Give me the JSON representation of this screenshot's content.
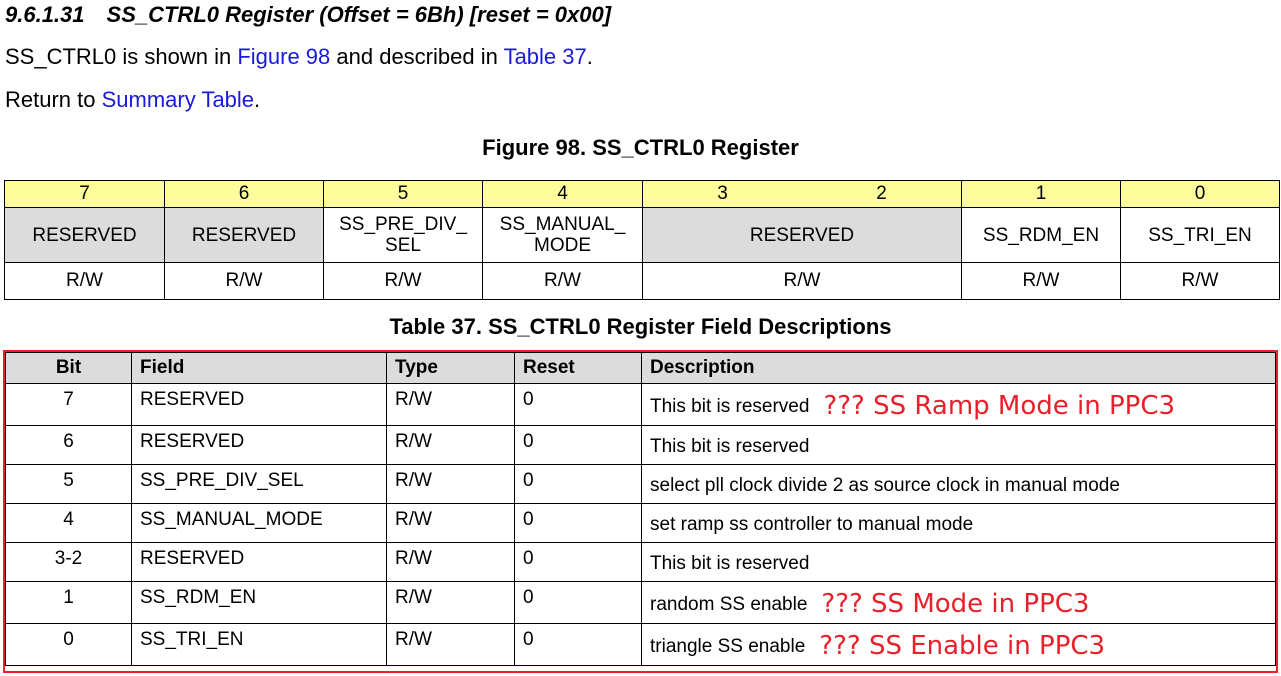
{
  "section": {
    "number": "9.6.1.31",
    "title": "SS_CTRL0 Register (Offset = 6Bh) [reset = 0x00]"
  },
  "intro": {
    "p1_prefix": "SS_CTRL0 is shown in ",
    "figure_link": "Figure 98",
    "p1_mid": " and described in ",
    "table_link": "Table 37",
    "p1_suffix": ".",
    "p2_prefix": "Return to ",
    "summary_link": "Summary Table",
    "p2_suffix": "."
  },
  "figure": {
    "title": "Figure 98.  SS_CTRL0 Register",
    "bits": [
      "7",
      "6",
      "5",
      "4",
      "3",
      "2",
      "1",
      "0"
    ],
    "fields": [
      {
        "name": "RESERVED",
        "access": "R/W",
        "reserved": true
      },
      {
        "name": "RESERVED",
        "access": "R/W",
        "reserved": true
      },
      {
        "name": "SS_PRE_DIV_",
        "name2": "SEL",
        "access": "R/W",
        "reserved": false
      },
      {
        "name": "SS_MANUAL_",
        "name2": "MODE",
        "access": "R/W",
        "reserved": false
      },
      {
        "name": "RESERVED",
        "access": "R/W",
        "reserved": true
      },
      {
        "name": "SS_RDM_EN",
        "access": "R/W",
        "reserved": false
      },
      {
        "name": "SS_TRI_EN",
        "access": "R/W",
        "reserved": false
      }
    ]
  },
  "table": {
    "title": "Table 37. SS_CTRL0 Register Field Descriptions",
    "headers": [
      "Bit",
      "Field",
      "Type",
      "Reset",
      "Description"
    ],
    "rows": [
      {
        "bit": "7",
        "field": "RESERVED",
        "type": "R/W",
        "reset": "0",
        "desc": "This bit is reserved",
        "note": "??? SS Ramp Mode in PPC3"
      },
      {
        "bit": "6",
        "field": "RESERVED",
        "type": "R/W",
        "reset": "0",
        "desc": "This bit is reserved",
        "note": ""
      },
      {
        "bit": "5",
        "field": "SS_PRE_DIV_SEL",
        "type": "R/W",
        "reset": "0",
        "desc": "select pll clock divide 2 as source clock in manual mode",
        "note": ""
      },
      {
        "bit": "4",
        "field": "SS_MANUAL_MODE",
        "type": "R/W",
        "reset": "0",
        "desc": "set ramp ss controller to manual mode",
        "note": ""
      },
      {
        "bit": "3-2",
        "field": "RESERVED",
        "type": "R/W",
        "reset": "0",
        "desc": "This bit is reserved",
        "note": ""
      },
      {
        "bit": "1",
        "field": "SS_RDM_EN",
        "type": "R/W",
        "reset": "0",
        "desc": "random SS enable",
        "note": "??? SS Mode in PPC3"
      },
      {
        "bit": "0",
        "field": "SS_TRI_EN",
        "type": "R/W",
        "reset": "0",
        "desc": "triangle SS enable",
        "note": "??? SS Enable in PPC3"
      }
    ]
  },
  "colors": {
    "link": "#1a1ad9",
    "annotation": "#e8202a",
    "bit_header_bg": "#fdfd9c",
    "reserved_bg": "#dcdcdc"
  }
}
